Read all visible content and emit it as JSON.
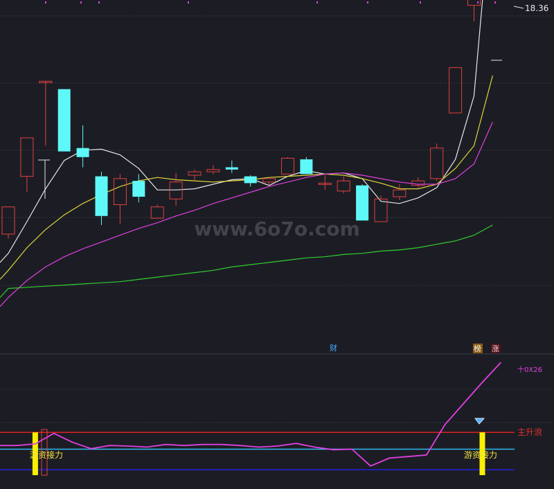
{
  "chart_data": {
    "type": "candlestick",
    "price_label": "18.36",
    "watermark": "www.6o7o.com",
    "badges": {
      "cai": "财",
      "bang": "榜",
      "zhang": "涨"
    },
    "candles": [
      {
        "o": 11.27,
        "c": 11.51,
        "h": 11.51,
        "l": 11.23
      },
      {
        "o": 11.78,
        "c": 12.12,
        "h": 12.12,
        "l": 11.64
      },
      {
        "o": 12.62,
        "c": 12.62,
        "h": 12.62,
        "l": 12.05
      },
      {
        "o": 12.55,
        "c": 12.0,
        "h": 12.55,
        "l": 12.0
      },
      {
        "o": 12.03,
        "c": 11.95,
        "h": 12.23,
        "l": 11.86
      },
      {
        "o": 11.78,
        "c": 11.43,
        "h": 11.82,
        "l": 11.35
      },
      {
        "o": 11.53,
        "c": 11.76,
        "h": 11.8,
        "l": 11.36
      },
      {
        "o": 11.74,
        "c": 11.6,
        "h": 11.8,
        "l": 11.55
      },
      {
        "o": 11.41,
        "c": 11.51,
        "h": 11.53,
        "l": 11.41
      },
      {
        "o": 11.58,
        "c": 11.73,
        "h": 11.81,
        "l": 11.52
      },
      {
        "o": 11.79,
        "c": 11.82,
        "h": 11.84,
        "l": 11.74
      },
      {
        "o": 11.82,
        "c": 11.84,
        "h": 11.88,
        "l": 11.8
      },
      {
        "o": 11.86,
        "c": 11.84,
        "h": 11.92,
        "l": 11.81
      },
      {
        "o": 11.78,
        "c": 11.72,
        "h": 11.79,
        "l": 11.69
      },
      {
        "o": 11.73,
        "c": 11.76,
        "h": 11.76,
        "l": 11.7
      },
      {
        "o": 11.8,
        "c": 11.94,
        "h": 11.95,
        "l": 11.8
      },
      {
        "o": 11.93,
        "c": 11.8,
        "h": 11.95,
        "l": 11.8
      },
      {
        "o": 11.72,
        "c": 11.72,
        "h": 11.8,
        "l": 11.66
      },
      {
        "o": 11.65,
        "c": 11.74,
        "h": 11.78,
        "l": 11.63
      },
      {
        "o": 11.7,
        "c": 11.39,
        "h": 11.71,
        "l": 11.39
      },
      {
        "o": 11.38,
        "c": 11.58,
        "h": 11.61,
        "l": 11.38
      },
      {
        "o": 11.6,
        "c": 11.66,
        "h": 11.71,
        "l": 11.57
      },
      {
        "o": 11.7,
        "c": 11.74,
        "h": 11.77,
        "l": 11.68
      },
      {
        "o": 11.76,
        "c": 12.03,
        "h": 12.07,
        "l": 11.74
      },
      {
        "o": 12.34,
        "c": 12.74,
        "h": 12.74,
        "l": 12.34
      },
      {
        "o": 13.29,
        "c": 13.56,
        "h": 13.56,
        "l": 13.15
      },
      {
        "o": 17.92,
        "c": 18.28,
        "h": 18.36,
        "l": 16.45
      }
    ],
    "ma_series": [
      {
        "color": "#e8e8e8",
        "values": [
          11.1,
          11.38,
          11.67,
          11.92,
          12.01,
          12.02,
          11.97,
          11.85,
          11.66,
          11.66,
          11.67,
          11.71,
          11.75,
          11.76,
          11.7,
          11.78,
          11.83,
          11.8,
          11.81,
          11.76,
          11.56,
          11.54,
          11.59,
          11.68,
          11.93,
          12.49,
          14.35
        ]
      },
      {
        "color": "#e0d83a",
        "values": [
          10.95,
          11.15,
          11.31,
          11.44,
          11.54,
          11.62,
          11.69,
          11.74,
          11.77,
          11.75,
          11.74,
          11.73,
          11.74,
          11.75,
          11.77,
          11.78,
          11.79,
          11.8,
          11.79,
          11.76,
          11.72,
          11.67,
          11.67,
          11.71,
          11.85,
          12.05,
          12.67
        ]
      },
      {
        "color": "#e040e0",
        "values": [
          10.71,
          10.86,
          10.98,
          11.07,
          11.14,
          11.2,
          11.26,
          11.32,
          11.37,
          11.43,
          11.48,
          11.54,
          11.59,
          11.64,
          11.69,
          11.73,
          11.77,
          11.8,
          11.81,
          11.79,
          11.76,
          11.73,
          11.71,
          11.71,
          11.76,
          11.89,
          12.26
        ]
      },
      {
        "color": "#30d030",
        "values": [
          10.79,
          10.8,
          10.81,
          10.82,
          10.83,
          10.84,
          10.85,
          10.87,
          10.89,
          10.91,
          10.93,
          10.95,
          10.98,
          11.0,
          11.02,
          11.04,
          11.06,
          11.07,
          11.09,
          11.1,
          11.12,
          11.13,
          11.15,
          11.18,
          11.21,
          11.26,
          11.35
        ]
      }
    ],
    "indicator": {
      "line_values": [
        55,
        58,
        78,
        61,
        49,
        55,
        54,
        52,
        57,
        55,
        57,
        57,
        55,
        52,
        54,
        59,
        52,
        47,
        48,
        16,
        31,
        34,
        37,
        95,
        135,
        175,
        213
      ],
      "red_level": 80,
      "blue_level": 48,
      "navy_level": 9,
      "red_label": "主升浪",
      "top_label": "十0X26",
      "signal_label": "游资接力",
      "signal_bars": [
        1,
        25
      ]
    }
  }
}
